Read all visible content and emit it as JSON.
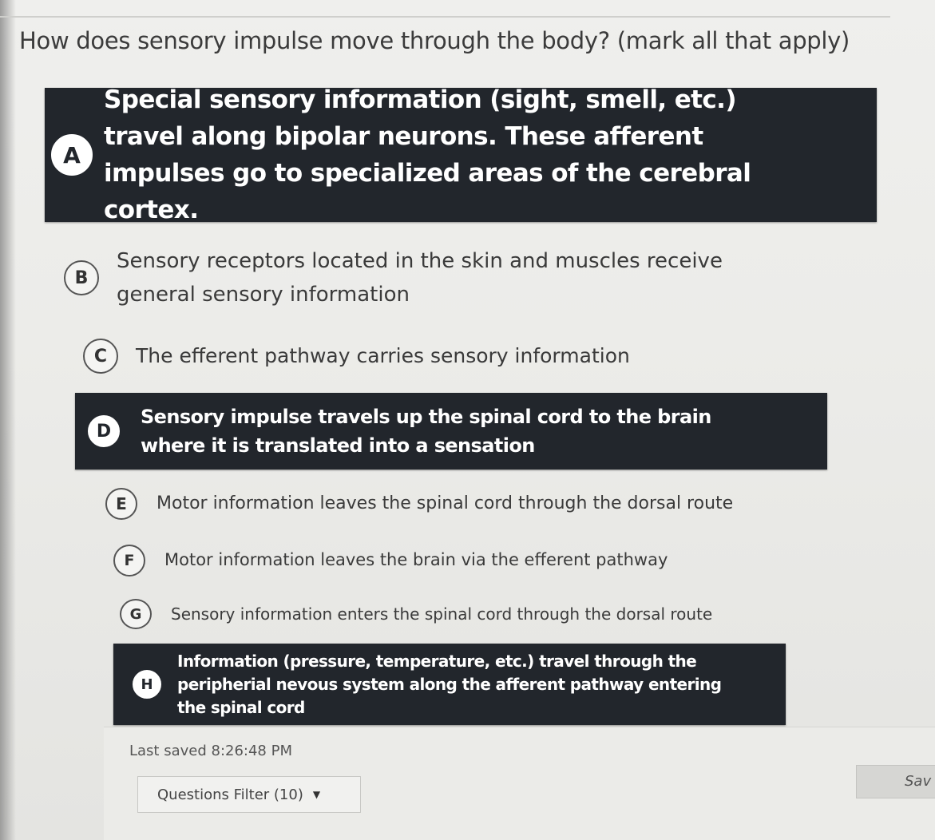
{
  "question": {
    "text": "How does sensory impulse move through the body? (mark all that apply)"
  },
  "options": [
    {
      "letter": "A",
      "text": "Special sensory information (sight, smell, etc.) travel along bipolar neurons. These afferent impulses go to specialized areas of the cerebral cortex.",
      "selected": true
    },
    {
      "letter": "B",
      "text": "Sensory receptors located in the skin and muscles receive general sensory information",
      "selected": false
    },
    {
      "letter": "C",
      "text": "The efferent pathway carries sensory information",
      "selected": false
    },
    {
      "letter": "D",
      "text": "Sensory impulse travels up the spinal cord to the brain where it is translated into a sensation",
      "selected": true
    },
    {
      "letter": "E",
      "text": "Motor information leaves the spinal cord through the dorsal route",
      "selected": false
    },
    {
      "letter": "F",
      "text": "Motor information leaves the brain via the efferent pathway",
      "selected": false
    },
    {
      "letter": "G",
      "text": "Sensory information enters the spinal cord through the dorsal route",
      "selected": false
    },
    {
      "letter": "H",
      "text": "Information (pressure, temperature, etc.) travel through the peripherial nevous system along the afferent pathway entering the spinal cord",
      "selected": true
    }
  ],
  "footer": {
    "last_saved": "Last saved 8:26:48 PM",
    "filter_label": "Questions Filter (10)",
    "save_label": "Sav"
  }
}
